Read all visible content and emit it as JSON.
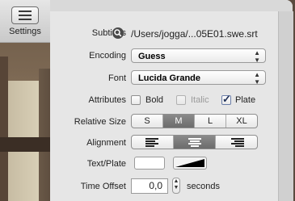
{
  "toolbar": {
    "settings_label": "Settings",
    "settings_icon": "sliders-icon"
  },
  "subtitles": {
    "label": "Subtitles",
    "path": "/Users/jogga/...05E01.swe.srt",
    "icon": "search-icon"
  },
  "encoding": {
    "label": "Encoding",
    "value": "Guess"
  },
  "font": {
    "label": "Font",
    "value": "Lucida Grande"
  },
  "attributes": {
    "label": "Attributes",
    "bold": {
      "label": "Bold",
      "checked": false
    },
    "italic": {
      "label": "Italic",
      "checked": false,
      "disabled": true
    },
    "plate": {
      "label": "Plate",
      "checked": true
    }
  },
  "relative_size": {
    "label": "Relative Size",
    "options": [
      "S",
      "M",
      "L",
      "XL"
    ],
    "selected": "M"
  },
  "alignment": {
    "label": "Alignment",
    "selected": "center"
  },
  "text_plate": {
    "label": "Text/Plate",
    "text_color": "#ffffff",
    "plate_color": "#000000"
  },
  "time_offset": {
    "label": "Time Offset",
    "value": "0,0",
    "unit": "seconds"
  }
}
